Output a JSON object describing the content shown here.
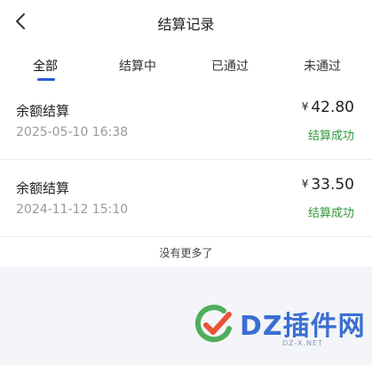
{
  "header": {
    "title": "结算记录"
  },
  "tabs": [
    {
      "label": "全部",
      "active": true
    },
    {
      "label": "结算中",
      "active": false
    },
    {
      "label": "已通过",
      "active": false
    },
    {
      "label": "未通过",
      "active": false
    }
  ],
  "records": [
    {
      "name": "余额结算",
      "date": "2025-05-10 16:38",
      "currency": "¥",
      "amount": "42.80",
      "status": "结算成功"
    },
    {
      "name": "余额结算",
      "date": "2024-11-12 15:10",
      "currency": "¥",
      "amount": "33.50",
      "status": "结算成功"
    }
  ],
  "footer": {
    "no_more": "没有更多了"
  },
  "watermark": {
    "brand": "DZ插件网",
    "site": "DZ-X.NET"
  },
  "colors": {
    "accent": "#2a5bd7",
    "success": "#2e9b3b",
    "background": "#f4f5f9"
  },
  "icons": {
    "back": "chevron-left-icon"
  }
}
